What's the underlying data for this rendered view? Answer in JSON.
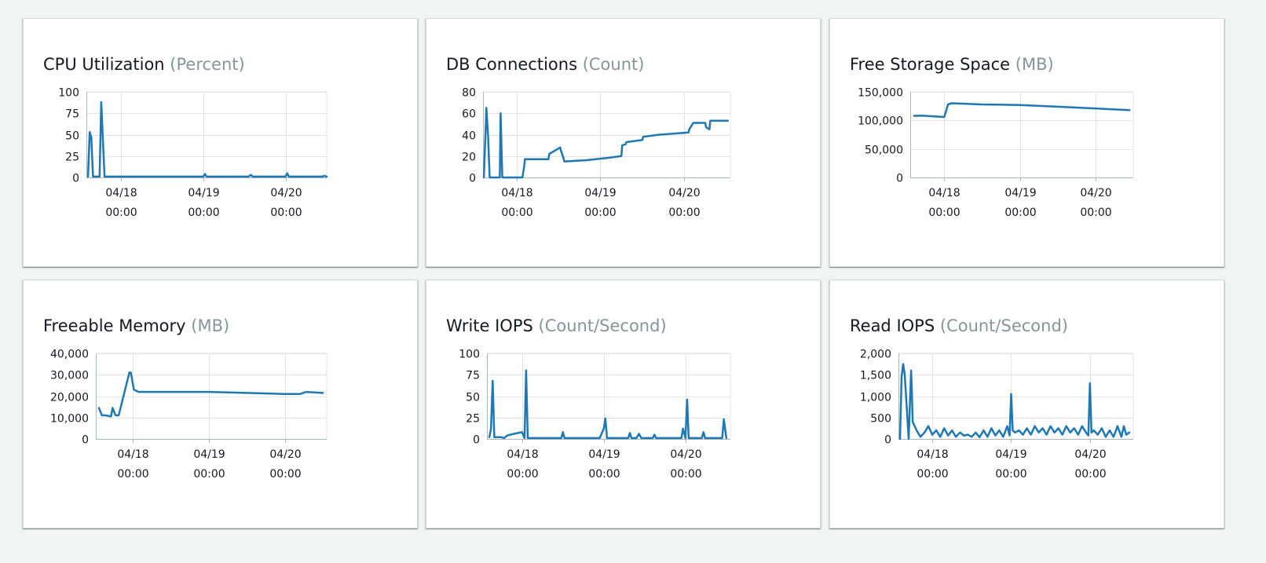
{
  "colors": {
    "series": "#1f77b4",
    "grid": "#e4e4e4",
    "unit": "#879596",
    "background": "#f2f3f3"
  },
  "chart_data": [
    {
      "type": "line",
      "title": "CPU Utilization",
      "unit": "(Percent)",
      "ylim": [
        0,
        100
      ],
      "yticks": [
        0,
        25,
        50,
        75,
        100
      ],
      "ytick_labels": [
        "0",
        "25",
        "50",
        "75",
        "100"
      ],
      "xlim": [
        -0.42,
        2.5
      ],
      "xticks": [
        0,
        1,
        2
      ],
      "xtick_labels": [
        [
          "04/18",
          "00:00"
        ],
        [
          "04/19",
          "00:00"
        ],
        [
          "04/20",
          "00:00"
        ]
      ],
      "grid": true,
      "series": [
        {
          "x": [
            -0.4,
            -0.38,
            -0.36,
            -0.34,
            -0.33,
            -0.31,
            -0.26,
            -0.24,
            -0.2,
            -0.18,
            -0.16,
            0.0,
            0.4,
            0.9,
            1.0,
            1.02,
            1.04,
            1.4,
            1.55,
            1.58,
            1.6,
            1.9,
            2.0,
            2.02,
            2.04,
            2.3,
            2.45,
            2.47,
            2.5
          ],
          "y": [
            1,
            53,
            47,
            1,
            1,
            1,
            1,
            88,
            1,
            1,
            1,
            1,
            1,
            1,
            1,
            4,
            1,
            1,
            1,
            3,
            1,
            1,
            1,
            5,
            1,
            1,
            1,
            2,
            1
          ]
        }
      ]
    },
    {
      "type": "line",
      "title": "DB Connections",
      "unit": "(Count)",
      "ylim": [
        0,
        80
      ],
      "yticks": [
        0,
        20,
        40,
        60,
        80
      ],
      "ytick_labels": [
        "0",
        "20",
        "40",
        "60",
        "80"
      ],
      "xlim": [
        -0.4,
        2.55
      ],
      "xticks": [
        0,
        1,
        2
      ],
      "xtick_labels": [
        [
          "04/18",
          "00:00"
        ],
        [
          "04/19",
          "00:00"
        ],
        [
          "04/20",
          "00:00"
        ]
      ],
      "grid": true,
      "series": [
        {
          "x": [
            -0.39,
            -0.37,
            -0.36,
            -0.34,
            -0.32,
            -0.2,
            -0.19,
            -0.17,
            0.07,
            0.09,
            0.1,
            0.38,
            0.39,
            0.52,
            0.53,
            0.56,
            0.57,
            0.8,
            0.81,
            1.05,
            1.06,
            1.25,
            1.26,
            1.3,
            1.31,
            1.5,
            1.51,
            1.7,
            1.71,
            2.05,
            2.06,
            2.1,
            2.11,
            2.25,
            2.26,
            2.3,
            2.31,
            2.52
          ],
          "y": [
            0,
            42,
            65,
            40,
            0,
            0,
            60,
            0,
            0,
            10,
            17,
            17,
            22,
            28,
            25,
            18,
            15,
            16,
            16,
            18,
            18,
            20,
            30,
            31,
            33,
            35,
            38,
            40,
            40,
            42,
            45,
            50,
            51,
            51,
            47,
            45,
            53,
            53
          ]
        }
      ]
    },
    {
      "type": "line",
      "title": "Free Storage Space",
      "unit": "(MB)",
      "ylim": [
        0,
        150000
      ],
      "yticks": [
        0,
        50000,
        100000,
        150000
      ],
      "ytick_labels": [
        "0",
        "50,000",
        "100,000",
        "150,000"
      ],
      "xlim": [
        -0.45,
        2.5
      ],
      "xticks": [
        0,
        1,
        2
      ],
      "xtick_labels": [
        [
          "04/18",
          "00:00"
        ],
        [
          "04/19",
          "00:00"
        ],
        [
          "04/20",
          "00:00"
        ]
      ],
      "grid": true,
      "series": [
        {
          "x": [
            -0.4,
            -0.3,
            0.0,
            0.05,
            0.1,
            0.5,
            1.0,
            1.5,
            2.0,
            2.45
          ],
          "y": [
            108000,
            108500,
            106000,
            128000,
            130000,
            128000,
            127000,
            124000,
            121000,
            118000
          ]
        }
      ]
    },
    {
      "type": "line",
      "title": "Freeable Memory",
      "unit": "(MB)",
      "ylim": [
        0,
        40000
      ],
      "yticks": [
        0,
        10000,
        20000,
        30000,
        40000
      ],
      "ytick_labels": [
        "0",
        "10,000",
        "20,000",
        "30,000",
        "40,000"
      ],
      "xlim": [
        -0.48,
        2.55
      ],
      "xticks": [
        0,
        1,
        2
      ],
      "xtick_labels": [
        [
          "04/18",
          "00:00"
        ],
        [
          "04/19",
          "00:00"
        ],
        [
          "04/20",
          "00:00"
        ]
      ],
      "grid": true,
      "series": [
        {
          "x": [
            -0.44,
            -0.4,
            -0.35,
            -0.28,
            -0.26,
            -0.22,
            -0.18,
            -0.04,
            -0.02,
            0.02,
            0.08,
            0.5,
            1.0,
            1.5,
            2.0,
            2.2,
            2.28,
            2.5
          ],
          "y": [
            14500,
            11000,
            11000,
            10500,
            14500,
            11000,
            11000,
            31000,
            31000,
            23000,
            22000,
            22000,
            22000,
            21500,
            21000,
            21000,
            22000,
            21500
          ]
        }
      ]
    },
    {
      "type": "line",
      "title": "Write IOPS",
      "unit": "(Count/Second)",
      "ylim": [
        0,
        100
      ],
      "yticks": [
        0,
        25,
        50,
        75,
        100
      ],
      "ytick_labels": [
        "0",
        "25",
        "50",
        "75",
        "100"
      ],
      "xlim": [
        -0.43,
        2.55
      ],
      "xticks": [
        0,
        1,
        2
      ],
      "xtick_labels": [
        [
          "04/18",
          "00:00"
        ],
        [
          "04/19",
          "00:00"
        ],
        [
          "04/20",
          "00:00"
        ]
      ],
      "grid": true,
      "series": [
        {
          "x": [
            -0.4,
            -0.38,
            -0.36,
            -0.34,
            -0.3,
            -0.25,
            -0.22,
            -0.18,
            -0.1,
            0.0,
            0.03,
            0.05,
            0.07,
            0.2,
            0.35,
            0.48,
            0.5,
            0.52,
            0.7,
            0.95,
            1.0,
            1.02,
            1.04,
            1.3,
            1.32,
            1.34,
            1.4,
            1.43,
            1.46,
            1.6,
            1.62,
            1.64,
            1.95,
            1.97,
            2.0,
            2.02,
            2.04,
            2.2,
            2.22,
            2.24,
            2.45,
            2.47,
            2.5
          ],
          "y": [
            2,
            12,
            68,
            2,
            2,
            2,
            1,
            4,
            6,
            8,
            1,
            80,
            1,
            1,
            1,
            1,
            8,
            1,
            1,
            1,
            12,
            24,
            1,
            1,
            7,
            1,
            1,
            6,
            1,
            1,
            5,
            1,
            1,
            12,
            1,
            46,
            1,
            1,
            8,
            1,
            1,
            23,
            1
          ]
        }
      ]
    },
    {
      "type": "line",
      "title": "Read IOPS",
      "unit": "(Count/Second)",
      "ylim": [
        0,
        2000
      ],
      "yticks": [
        0,
        500,
        1000,
        1500,
        2000
      ],
      "ytick_labels": [
        "0",
        "500",
        "1,000",
        "1,500",
        "2,000"
      ],
      "xlim": [
        -0.43,
        2.55
      ],
      "xticks": [
        0,
        1,
        2
      ],
      "xtick_labels": [
        [
          "04/18",
          "00:00"
        ],
        [
          "04/19",
          "00:00"
        ],
        [
          "04/20",
          "00:00"
        ]
      ],
      "grid": true,
      "series": [
        {
          "x": [
            -0.41,
            -0.39,
            -0.37,
            -0.35,
            -0.3,
            -0.27,
            -0.26,
            -0.25,
            -0.2,
            -0.15,
            -0.1,
            -0.05,
            0.0,
            0.05,
            0.1,
            0.15,
            0.2,
            0.25,
            0.3,
            0.35,
            0.4,
            0.45,
            0.5,
            0.55,
            0.6,
            0.65,
            0.7,
            0.75,
            0.8,
            0.85,
            0.9,
            0.95,
            0.98,
            1.0,
            1.02,
            1.05,
            1.1,
            1.15,
            1.2,
            1.25,
            1.3,
            1.35,
            1.4,
            1.45,
            1.5,
            1.55,
            1.6,
            1.65,
            1.7,
            1.75,
            1.8,
            1.85,
            1.9,
            1.95,
            1.98,
            2.0,
            2.02,
            2.05,
            2.1,
            2.15,
            2.2,
            2.25,
            2.3,
            2.35,
            2.4,
            2.43,
            2.46,
            2.5
          ],
          "y": [
            0,
            1450,
            1750,
            1500,
            0,
            1600,
            1100,
            400,
            200,
            50,
            150,
            300,
            100,
            200,
            50,
            250,
            80,
            200,
            50,
            150,
            80,
            100,
            50,
            150,
            40,
            200,
            50,
            250,
            80,
            200,
            50,
            300,
            80,
            1050,
            200,
            150,
            200,
            100,
            250,
            100,
            300,
            150,
            250,
            100,
            300,
            150,
            250,
            100,
            300,
            150,
            250,
            100,
            300,
            150,
            80,
            1300,
            150,
            200,
            100,
            250,
            50,
            200,
            50,
            300,
            50,
            300,
            100,
            150
          ]
        }
      ]
    }
  ]
}
